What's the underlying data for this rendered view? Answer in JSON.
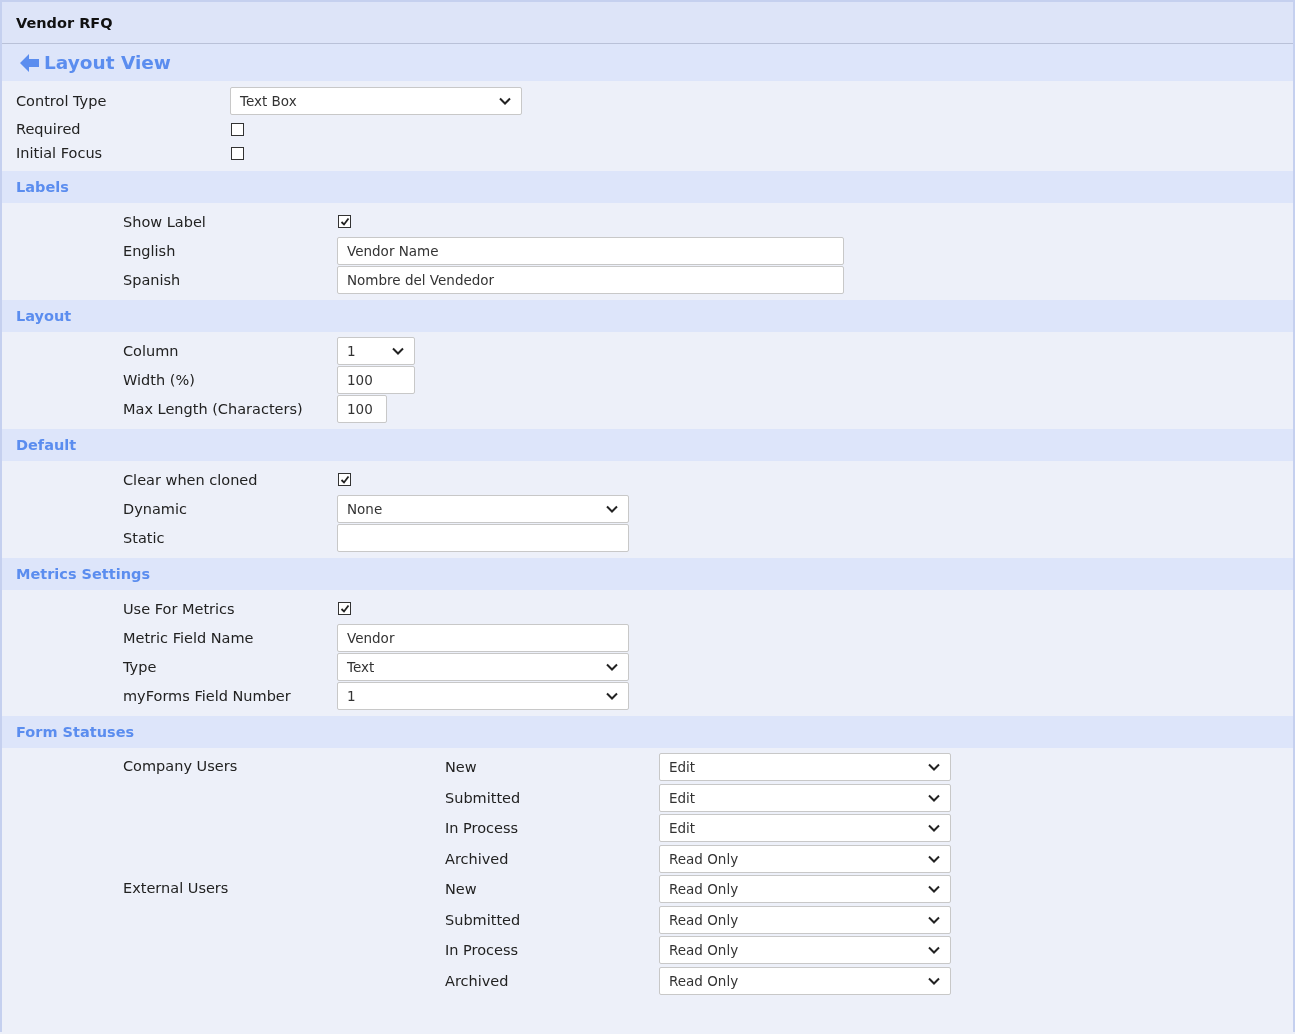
{
  "window": {
    "title": "Vendor RFQ"
  },
  "back_link": {
    "label": "Layout View"
  },
  "general": [
    {
      "label": "Control Type",
      "kind": "select",
      "value": "Text Box"
    },
    {
      "label": "Required",
      "kind": "checkbox",
      "checked": false
    },
    {
      "label": "Initial Focus",
      "kind": "checkbox",
      "checked": false
    }
  ],
  "sections": [
    {
      "title": "Labels",
      "fields": [
        {
          "label": "Show Label",
          "kind": "checkbox",
          "checked": true
        },
        {
          "label": "English",
          "kind": "text",
          "value": "Vendor Name"
        },
        {
          "label": "Spanish",
          "kind": "text",
          "value": "Nombre del Vendedor"
        }
      ]
    },
    {
      "title": "Layout",
      "fields": [
        {
          "label": "Column",
          "kind": "select",
          "value": "1"
        },
        {
          "label": "Width (%)",
          "kind": "text",
          "value": "100"
        },
        {
          "label": "Max Length (Characters)",
          "kind": "text",
          "value": "100"
        }
      ]
    },
    {
      "title": "Default",
      "fields": [
        {
          "label": "Clear when cloned",
          "kind": "checkbox",
          "checked": true
        },
        {
          "label": "Dynamic",
          "kind": "select",
          "value": "None"
        },
        {
          "label": "Static",
          "kind": "text"
        }
      ]
    },
    {
      "title": "Metrics Settings",
      "fields": [
        {
          "label": "Use For Metrics",
          "kind": "checkbox",
          "checked": true
        },
        {
          "label": "Metric Field Name",
          "kind": "text",
          "value": "Vendor"
        },
        {
          "label": "Type",
          "kind": "select",
          "value": "Text"
        },
        {
          "label": "myForms Field Number",
          "kind": "select",
          "value": "1"
        }
      ]
    }
  ],
  "form_statuses": {
    "title": "Form Statuses",
    "groups": [
      {
        "label": "Company Users",
        "statuses": [
          {
            "status": "New",
            "value": "Edit"
          },
          {
            "status": "Submitted",
            "value": "Edit"
          },
          {
            "status": "In Process",
            "value": "Edit"
          },
          {
            "status": "Archived",
            "value": "Read Only"
          }
        ]
      },
      {
        "label": "External Users",
        "statuses": [
          {
            "status": "New",
            "value": "Read Only"
          },
          {
            "status": "Submitted",
            "value": "Read Only"
          },
          {
            "status": "In Process",
            "value": "Read Only"
          },
          {
            "status": "Archived",
            "value": "Read Only"
          }
        ]
      }
    ]
  }
}
